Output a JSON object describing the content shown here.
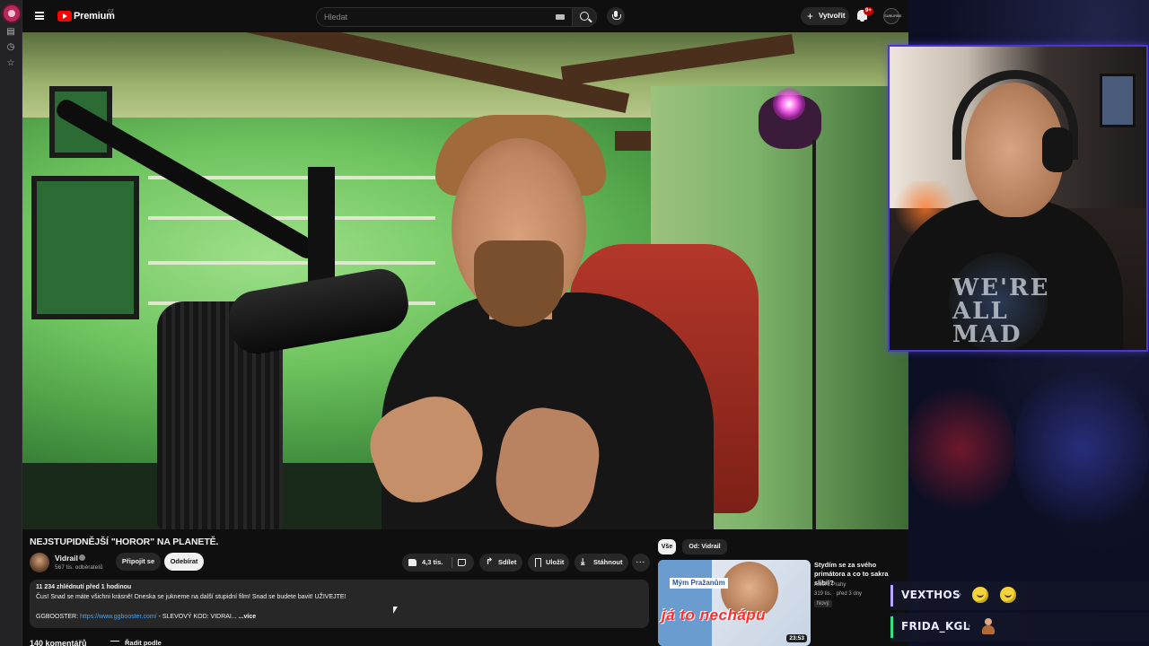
{
  "header": {
    "brand": "Premium",
    "region": "CZ",
    "search_placeholder": "Hledat",
    "create_label": "Vytvořit",
    "notifications_badge": "9+",
    "avatar_text": "SUBURBS"
  },
  "video": {
    "title": "NEJSTUPIDNĚJŠÍ \"HOROR\" NA PLANETĚ.",
    "channel": "Vidrail",
    "subscribers": "567 tis. odběratelů",
    "join_label": "Připojit se",
    "unsubscribe_label": "Odebírat",
    "likes": "4,3 tis.",
    "share_label": "Sdílet",
    "save_label": "Uložit",
    "download_label": "Stáhnout",
    "more_label": "···"
  },
  "description": {
    "meta": "11 234 zhlédnutí  před 1 hodinou",
    "line1": "Čus! Snad se máte všichni krásně! Dneska se jukneme na další stupidní film! Snad se budete bavit! UŽIVEJTE!",
    "line2_prefix": "GGBOOSTER: ",
    "line2_link": "https://www.ggbooster.com/",
    "line2_suffix": " - SLEVOVÝ KOD: VIDRAI...",
    "more": "...více"
  },
  "comments": {
    "count": "140 komentářů",
    "sort_label": "Řadit podle"
  },
  "recommended": {
    "chips": [
      "Vše",
      "Od: Vidrail"
    ],
    "item": {
      "title": "Stydím se za svého primátora a co to sakra slibil?",
      "channel": "Klucí z Prahy",
      "meta": "319 tis. · před 3 dny",
      "badge": "Nový",
      "duration": "23:53",
      "thumb_tag": "Mým Pražanům",
      "thumb_text": "já to nechápu"
    }
  },
  "chat": [
    {
      "name": "VEXTHOS",
      "color": "#b6a7ff"
    },
    {
      "name": "FRIDA_KGL",
      "color": "#38e08a"
    }
  ],
  "webcam": {
    "shirt_print": "WE'RE ALL MAD"
  }
}
